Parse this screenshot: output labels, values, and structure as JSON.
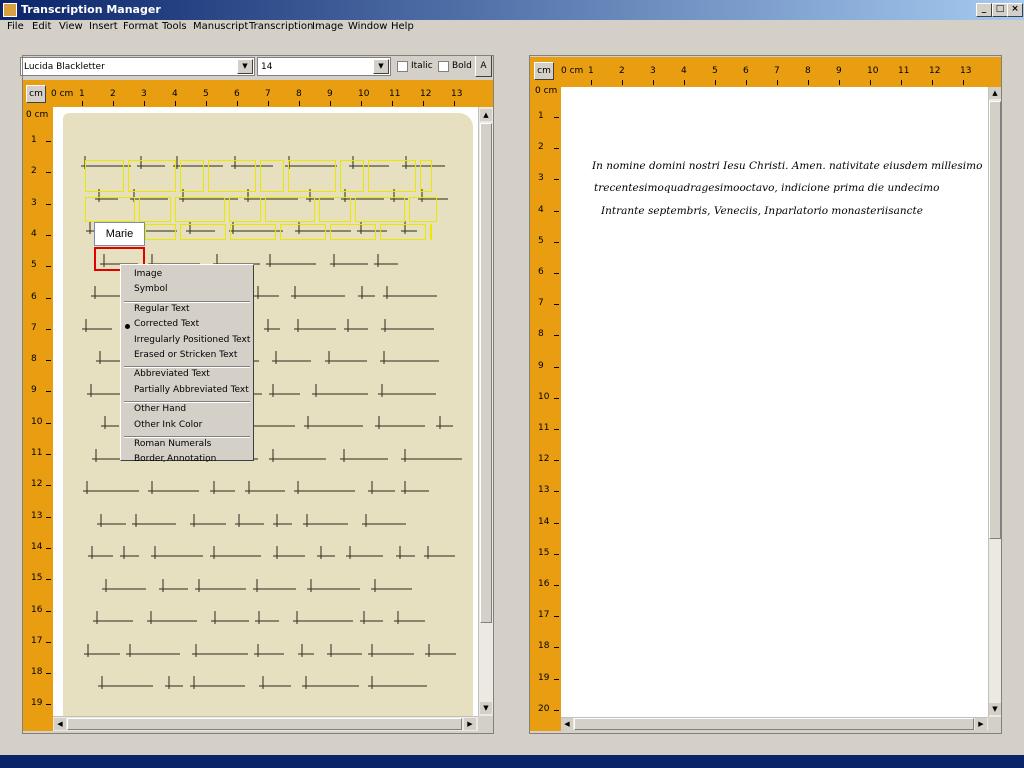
{
  "window": {
    "title": "Transcription Manager"
  },
  "menubar": [
    "File",
    "Edit",
    "View",
    "Insert",
    "Format",
    "Tools",
    "Manuscript",
    "Transcription",
    "Image",
    "Window",
    "Help"
  ],
  "toolbar": {
    "font": "Lucida Blackletter",
    "size": "14",
    "italic_label": "Italic",
    "bold_label": "Bold",
    "a_label": "A"
  },
  "ruler": {
    "unit": "cm",
    "origin_label": "0 cm",
    "left_h": [
      "1",
      "2",
      "3",
      "4",
      "5",
      "6",
      "7",
      "8",
      "9",
      "10",
      "11",
      "12",
      "13"
    ],
    "left_v": [
      "1",
      "2",
      "3",
      "4",
      "5",
      "6",
      "7",
      "8",
      "9",
      "10",
      "11",
      "12",
      "13",
      "14",
      "15",
      "16",
      "17",
      "18",
      "19"
    ],
    "right_h": [
      "1",
      "2",
      "3",
      "4",
      "5",
      "6",
      "7",
      "8",
      "9",
      "10",
      "11",
      "12",
      "13"
    ],
    "right_v": [
      "1",
      "2",
      "3",
      "4",
      "5",
      "6",
      "7",
      "8",
      "9",
      "10",
      "11",
      "12",
      "13",
      "14",
      "15",
      "16",
      "17",
      "18",
      "19",
      "20"
    ]
  },
  "word_input": {
    "value": "Marie"
  },
  "context_menu": {
    "groups": [
      [
        "Image",
        "Symbol"
      ],
      [
        "Regular Text",
        "Corrected Text",
        "Irregularly Positioned Text",
        "Erased or Stricken Text"
      ],
      [
        "Abbreviated Text",
        "Partially Abbreviated Text"
      ],
      [
        "Other Hand",
        "Other Ink Color"
      ],
      [
        "Roman Numerals",
        "Border Annotation"
      ]
    ],
    "checked": "Corrected Text"
  },
  "transcription": {
    "lines": [
      "In nomine domini nostri Iesu Christi. Amen. nativitate eiusdem millesimo",
      "trecentesimoquadragesimooctavo, indicione  prima  die  undecimo",
      "Intrante  septembris,  Veneciis,  Inparlatorio  monasteriisancte"
    ]
  }
}
